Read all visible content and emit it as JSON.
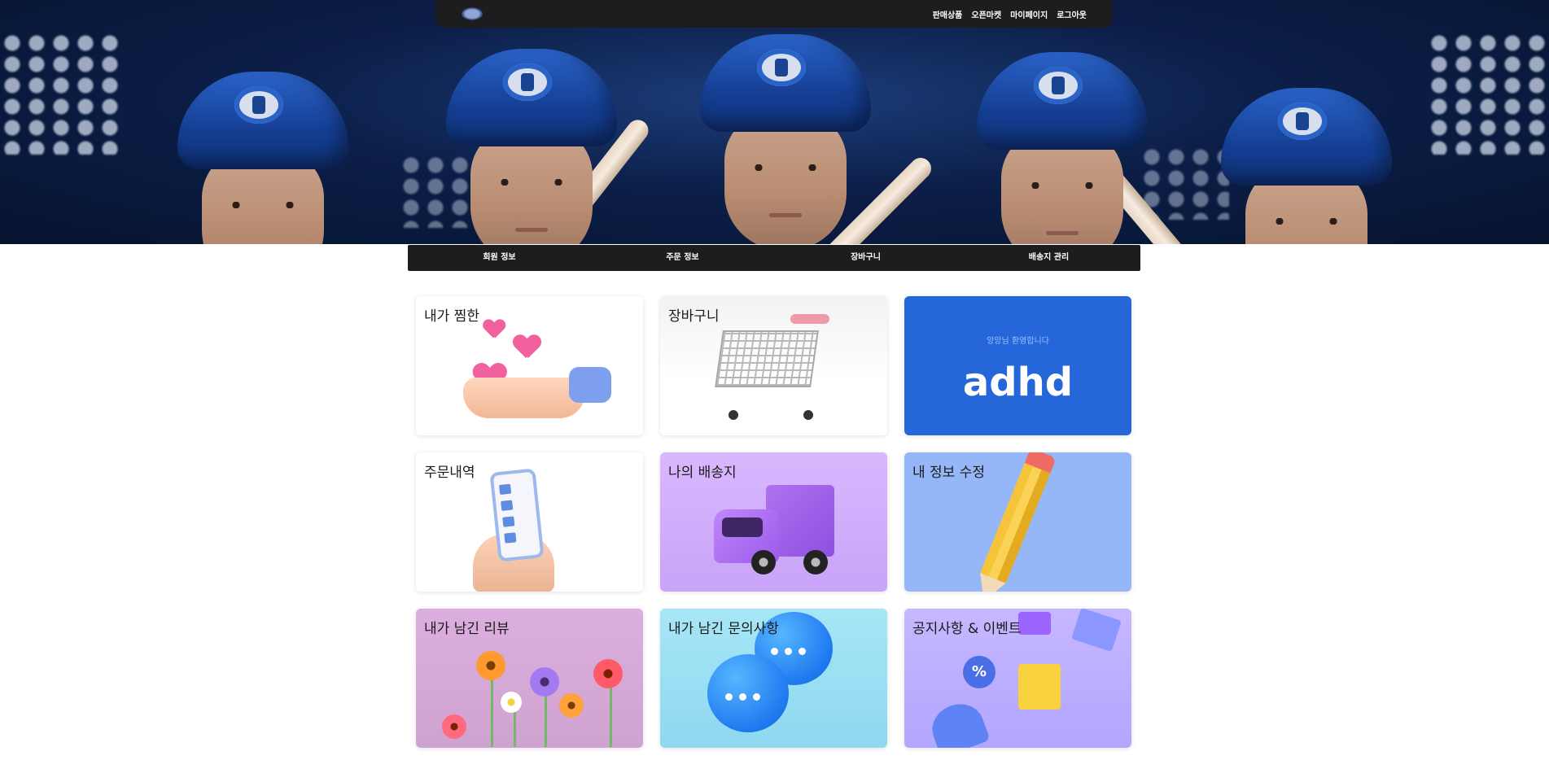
{
  "header": {
    "brand_icon": "dinos-logo-icon",
    "nav": [
      "판매상품",
      "오픈마켓",
      "마이페이지",
      "로그아웃"
    ]
  },
  "subnav": [
    "회원 정보",
    "주문 정보",
    "장바구니",
    "배송지 관리"
  ],
  "cards": [
    {
      "label": "내가 찜한",
      "icon": "heart-hand-icon",
      "bg": "#ffffff"
    },
    {
      "label": "장바구니",
      "icon": "shopping-cart-icon",
      "bg": "#f5f5f5"
    },
    {
      "label": "",
      "icon": "promo-banner",
      "bg": "#2567d8",
      "sub": "앙앙님 환영합니다",
      "big": "adhd"
    },
    {
      "label": "주문내역",
      "icon": "phone-checklist-icon",
      "bg": "#ffffff"
    },
    {
      "label": "나의 배송지",
      "icon": "truck-icon",
      "bg": "#d0acfb"
    },
    {
      "label": "내 정보 수정",
      "icon": "pencil-icon",
      "bg": "#95b6f7"
    },
    {
      "label": "내가 남긴 리뷰",
      "icon": "flowers-icon",
      "bg": "#d5a8d6"
    },
    {
      "label": "내가 남긴 문의사항",
      "icon": "chat-bubbles-icon",
      "bg": "#9ddff3"
    },
    {
      "label": "공지사항 & 이벤트",
      "icon": "shopping-event-icon",
      "bg": "#bcaeff"
    }
  ]
}
